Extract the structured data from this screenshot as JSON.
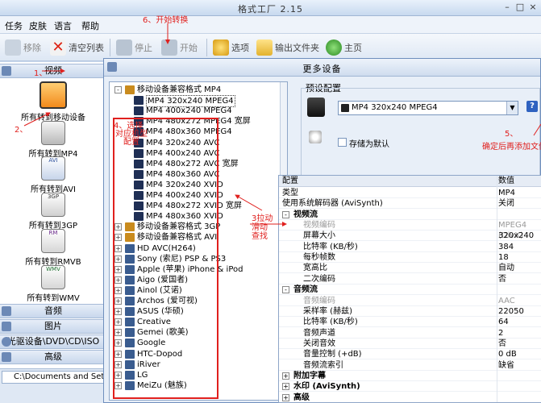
{
  "window": {
    "title": "格式工厂 2.15"
  },
  "menu": [
    "任务",
    "皮肤",
    "语言",
    "帮助"
  ],
  "toolbar": {
    "remove": "移除",
    "clear": "清空列表",
    "stop": "停止",
    "start": "开始",
    "options": "选项",
    "output": "输出文件夹",
    "home": "主页"
  },
  "sidebar": {
    "video_header": "视频",
    "items": [
      "所有转到移动设备",
      "所有转到MP4",
      "所有转到AVI",
      "所有转到3GP",
      "所有转到RMVB",
      "所有转到WMV"
    ],
    "icon_labels": [
      "",
      "",
      "AVI",
      "3GP",
      "RM",
      "WMV"
    ],
    "categories": [
      "音频",
      "图片",
      "光驱设备\\DVD\\CD\\ISO",
      "高级"
    ]
  },
  "status": {
    "path": "C:\\Documents and Settings\\"
  },
  "dialog": {
    "title": "更多设备",
    "tree": [
      {
        "label": "移动设备兼容格式 MP4",
        "level": 0,
        "exp": "-"
      },
      {
        "label": "MP4 320x240 MPEG4",
        "level": 1
      },
      {
        "label": "MP4 400x240 MPEG4",
        "level": 1
      },
      {
        "label": "MP4 480x272 MPEG4 宽屏",
        "level": 1
      },
      {
        "label": "MP4 480x360 MPEG4",
        "level": 1
      },
      {
        "label": "MP4 320x240 AVC",
        "level": 1
      },
      {
        "label": "MP4 400x240 AVC",
        "level": 1
      },
      {
        "label": "MP4 480x272 AVC 宽屏",
        "level": 1
      },
      {
        "label": "MP4 480x360 AVC",
        "level": 1
      },
      {
        "label": "MP4 320x240 XVID",
        "level": 1
      },
      {
        "label": "MP4 400x240 XVID",
        "level": 1
      },
      {
        "label": "MP4 480x272 XVID 宽屏",
        "level": 1
      },
      {
        "label": "MP4 480x360 XVID",
        "level": 1
      },
      {
        "label": "移动设备兼容格式 3GP",
        "level": 0,
        "exp": "+"
      },
      {
        "label": "移动设备兼容格式 AVI",
        "level": 0,
        "exp": "+"
      },
      {
        "label": "HD AVC(H264)",
        "level": 0,
        "exp": "+"
      },
      {
        "label": "Sony (索尼) PSP & PS3",
        "level": 0,
        "exp": "+"
      },
      {
        "label": "Apple (苹果) iPhone & iPod",
        "level": 0,
        "exp": "+"
      },
      {
        "label": "Aigo (爱国者)",
        "level": 0,
        "exp": "+"
      },
      {
        "label": "Ainol (艾诺)",
        "level": 0,
        "exp": "+"
      },
      {
        "label": "Archos (爱可视)",
        "level": 0,
        "exp": "+"
      },
      {
        "label": "ASUS (华硕)",
        "level": 0,
        "exp": "+"
      },
      {
        "label": "Creative",
        "level": 0,
        "exp": "+"
      },
      {
        "label": "Gemei (歌美)",
        "level": 0,
        "exp": "+"
      },
      {
        "label": "Google",
        "level": 0,
        "exp": "+"
      },
      {
        "label": "HTC-Dopod",
        "level": 0,
        "exp": "+"
      },
      {
        "label": "iRiver",
        "level": 0,
        "exp": "+"
      },
      {
        "label": "LG",
        "level": 0,
        "exp": "+"
      },
      {
        "label": "MeiZu (魅族)",
        "level": 0,
        "exp": "+"
      }
    ],
    "preset": {
      "label": "预设配置",
      "selected": "MP4 320x240 MPEG4",
      "save_default": "存储为默认"
    },
    "props_header": {
      "key": "配置",
      "value": "数值"
    },
    "props": [
      {
        "k": "类型",
        "v": "MP4",
        "t": "row0"
      },
      {
        "k": "使用系统解码器 (AviSynth)",
        "v": "关闭",
        "t": "row0"
      },
      {
        "k": "视频流",
        "v": "",
        "t": "grp"
      },
      {
        "k": "视频编码",
        "v": "MPEG4 (DivX)",
        "t": "dim"
      },
      {
        "k": "屏幕大小",
        "v": "320x240",
        "t": "row"
      },
      {
        "k": "比特率 (KB/秒)",
        "v": "384",
        "t": "row"
      },
      {
        "k": "每秒帧数",
        "v": "18",
        "t": "row"
      },
      {
        "k": "宽高比",
        "v": "自动",
        "t": "row"
      },
      {
        "k": "二次编码",
        "v": "否",
        "t": "row"
      },
      {
        "k": "音频流",
        "v": "",
        "t": "grp"
      },
      {
        "k": "音频编码",
        "v": "AAC",
        "t": "dim"
      },
      {
        "k": "采样率 (赫兹)",
        "v": "22050",
        "t": "row"
      },
      {
        "k": "比特率 (KB/秒)",
        "v": "64",
        "t": "row"
      },
      {
        "k": "音频声道",
        "v": "2",
        "t": "row"
      },
      {
        "k": "关闭音效",
        "v": "否",
        "t": "row"
      },
      {
        "k": "音量控制 (+dB)",
        "v": "0 dB",
        "t": "row"
      },
      {
        "k": "音频流索引",
        "v": "缺省",
        "t": "row"
      },
      {
        "k": "附加字幕",
        "v": "",
        "t": "grpc"
      },
      {
        "k": "水印 (AviSynth)",
        "v": "",
        "t": "grpc"
      },
      {
        "k": "高级",
        "v": "",
        "t": "grpc"
      }
    ]
  },
  "annotations": {
    "a1": "1、",
    "a2": "2、",
    "a4_1": "4、选择",
    "a4_2": "对应机型",
    "a4_3": "配置",
    "a5_1": "5、",
    "a5_2": "确定后再添加文件",
    "a6": "6、开始转换",
    "a3_1": "3拉动",
    "a3_2": "滑动",
    "a3_3": "查找"
  },
  "colors": {
    "annotation": "#e0201e",
    "accent": "#2f62c0"
  }
}
